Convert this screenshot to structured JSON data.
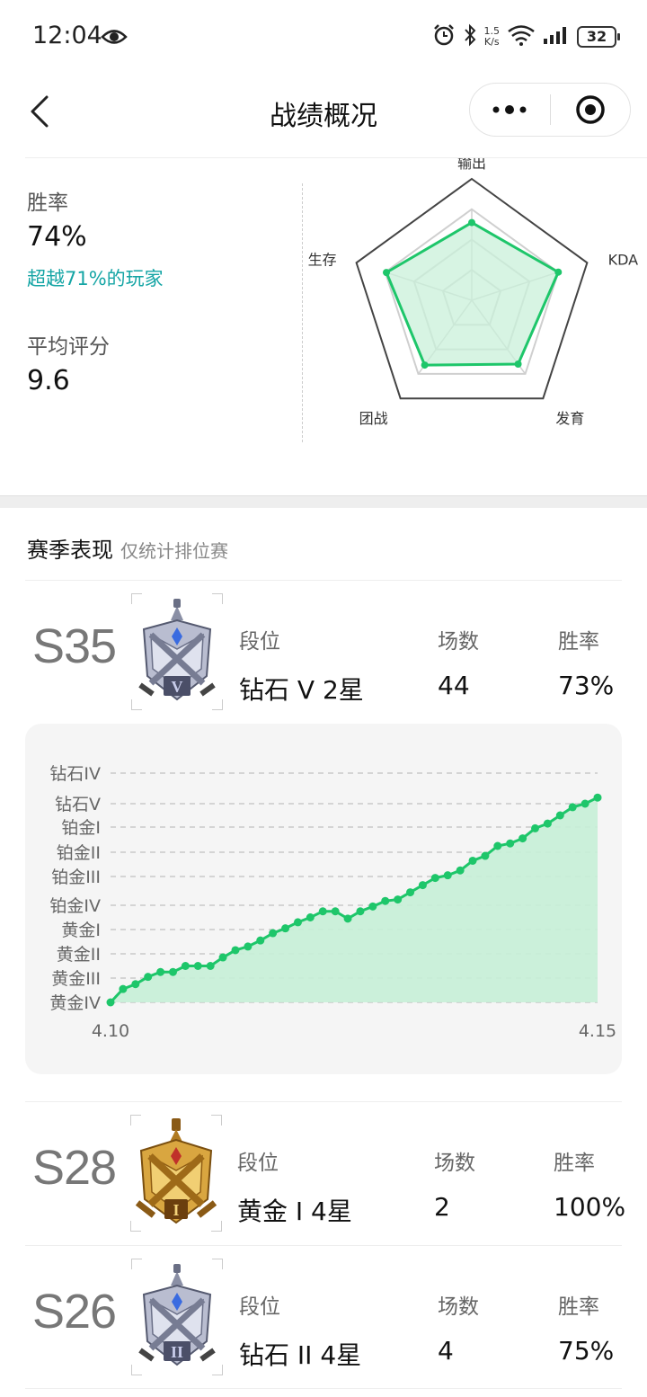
{
  "status_bar": {
    "time": "12:04",
    "net_speed_value": "1.5",
    "net_speed_unit": "K/s",
    "battery": "32",
    "icons": [
      "eye-icon",
      "alarm-icon",
      "bluetooth-icon",
      "wifi-icon",
      "signal-icon",
      "battery-icon"
    ]
  },
  "nav": {
    "title": "战绩概况",
    "more_icon": "more-dots-icon",
    "close_icon": "target-icon"
  },
  "overview": {
    "win_rate_label": "胜率",
    "win_rate_value": "74%",
    "win_rate_sub": "超越71%的玩家",
    "avg_score_label": "平均评分",
    "avg_score_value": "9.6",
    "radar": {
      "axes": [
        "输出",
        "KDA",
        "发育",
        "团战",
        "生存"
      ],
      "values": [
        0.64,
        0.75,
        0.65,
        0.66,
        0.74
      ],
      "line_color": "#1ec66a",
      "fill_color": "#c9f0d9"
    }
  },
  "season_section": {
    "title": "赛季表现",
    "subtitle": "仅统计排位赛",
    "col_labels": {
      "rank": "段位",
      "games": "场数",
      "winrate": "胜率"
    },
    "seasons": [
      {
        "id": "S35",
        "rank": "钻石 V 2星",
        "games": "44",
        "winrate": "73%",
        "badge": "diamond-badge-icon",
        "badge_numeral": "V"
      },
      {
        "id": "S28",
        "rank": "黄金 I 4星",
        "games": "2",
        "winrate": "100%",
        "badge": "gold-badge-icon",
        "badge_numeral": "I"
      },
      {
        "id": "S26",
        "rank": "钻石 II 4星",
        "games": "4",
        "winrate": "75%",
        "badge": "diamond-badge-icon",
        "badge_numeral": "II"
      }
    ]
  },
  "chart_data": {
    "type": "area",
    "x_start_label": "4.10",
    "x_end_label": "4.15",
    "y_categories": [
      "黄金IV",
      "黄金III",
      "黄金II",
      "黄金I",
      "铂金IV",
      "铂金III",
      "铂金II",
      "铂金I",
      "钻石V",
      "钻石IV"
    ],
    "values": [
      0.0,
      0.55,
      0.75,
      1.05,
      1.25,
      1.25,
      1.5,
      1.5,
      1.5,
      1.85,
      2.15,
      2.3,
      2.55,
      2.85,
      3.05,
      3.3,
      3.5,
      3.75,
      3.75,
      3.45,
      3.75,
      3.95,
      4.15,
      4.2,
      4.45,
      4.7,
      4.95,
      5.05,
      5.25,
      5.65,
      5.85,
      6.25,
      6.35,
      6.55,
      6.95,
      7.15,
      7.5,
      7.85,
      8.0,
      8.2
    ],
    "line_color": "#1ec66a",
    "fill_color": "#c6efd7",
    "grid": "dashed"
  }
}
